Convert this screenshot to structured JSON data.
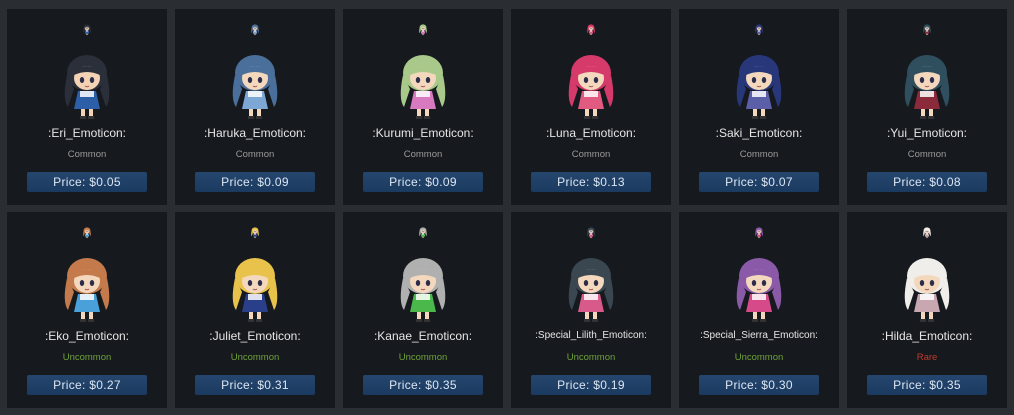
{
  "price_prefix": "Price: ",
  "cards": [
    {
      "name": ":Eri_Emoticon:",
      "rarity": "Common",
      "price": "$0.05",
      "hair": "#2a2f3a",
      "accent": "#2d5fa8",
      "skin": "#f3d3b4"
    },
    {
      "name": ":Haruka_Emoticon:",
      "rarity": "Common",
      "price": "$0.09",
      "hair": "#4a6f9a",
      "accent": "#7da8d6",
      "skin": "#f4d8bd"
    },
    {
      "name": ":Kurumi_Emoticon:",
      "rarity": "Common",
      "price": "$0.09",
      "hair": "#a8c98a",
      "accent": "#d87ac0",
      "skin": "#f4d8bd"
    },
    {
      "name": ":Luna_Emoticon:",
      "rarity": "Common",
      "price": "$0.13",
      "hair": "#d63a6a",
      "accent": "#e25a80",
      "skin": "#f4d8bd"
    },
    {
      "name": ":Saki_Emoticon:",
      "rarity": "Common",
      "price": "$0.07",
      "hair": "#28377a",
      "accent": "#5a5fa8",
      "skin": "#f4d8bd"
    },
    {
      "name": ":Yui_Emoticon:",
      "rarity": "Common",
      "price": "$0.08",
      "hair": "#2f4f5e",
      "accent": "#8a2a3a",
      "skin": "#f4d8bd"
    },
    {
      "name": ":Eko_Emoticon:",
      "rarity": "Uncommon",
      "price": "$0.27",
      "hair": "#c47a4a",
      "accent": "#4aa0d8",
      "skin": "#f4d8bd"
    },
    {
      "name": ":Juliet_Emoticon:",
      "rarity": "Uncommon",
      "price": "$0.31",
      "hair": "#e8c24a",
      "accent": "#2a3f8a",
      "skin": "#f4d8bd"
    },
    {
      "name": ":Kanae_Emoticon:",
      "rarity": "Uncommon",
      "price": "$0.35",
      "hair": "#b0b0b0",
      "accent": "#4ab84a",
      "skin": "#f4d8bd"
    },
    {
      "name": ":Special_Lilith_Emoticon:",
      "rarity": "Uncommon",
      "price": "$0.19",
      "hair": "#3a4650",
      "accent": "#d85a8a",
      "skin": "#f4d8bd"
    },
    {
      "name": ":Special_Sierra_Emoticon:",
      "rarity": "Uncommon",
      "price": "$0.30",
      "hair": "#8a5aa8",
      "accent": "#d64a8a",
      "skin": "#f4d8bd"
    },
    {
      "name": ":Hilda_Emoticon:",
      "rarity": "Rare",
      "price": "$0.35",
      "hair": "#f0eeea",
      "accent": "#c9a7b0",
      "skin": "#f4d8bd"
    }
  ]
}
